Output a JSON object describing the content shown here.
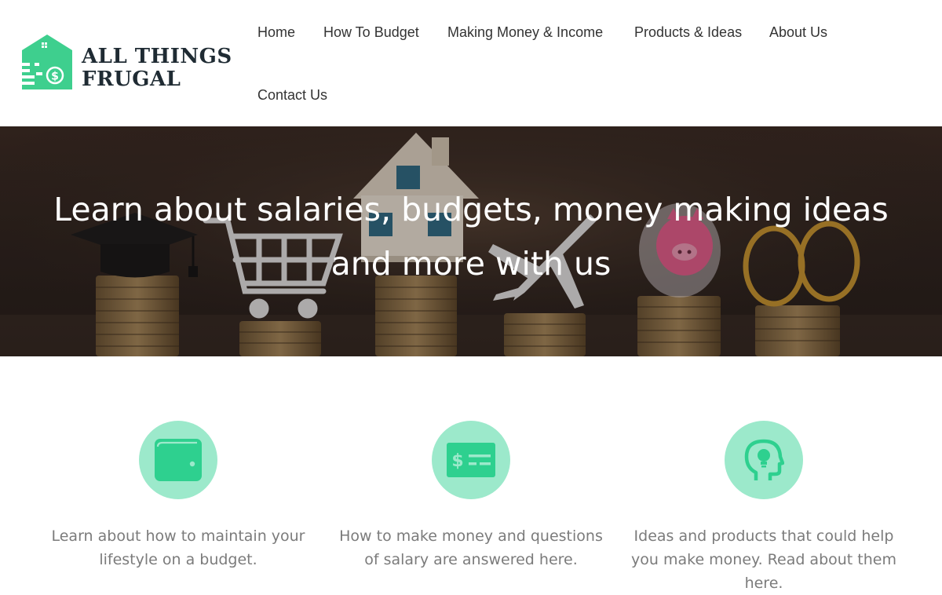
{
  "brand": {
    "line1": "ALL THINGS",
    "line2": "FRUGAL",
    "accent": "#3ecf8e",
    "dark": "#1f2b33"
  },
  "nav": {
    "items": [
      {
        "label": "Home"
      },
      {
        "label": "How To Budget"
      },
      {
        "label": "Making Money & Income"
      },
      {
        "label": "Products & Ideas"
      },
      {
        "label": "About Us"
      },
      {
        "label": "Contact Us"
      }
    ]
  },
  "hero": {
    "title": "Learn about salaries, budgets, money making ideas and more with us"
  },
  "features": [
    {
      "icon": "wallet-icon",
      "text": "Learn about how to maintain your lifestyle on a budget."
    },
    {
      "icon": "money-card-icon",
      "text": "How to make money and questions of salary are answered here."
    },
    {
      "icon": "head-lightbulb-icon",
      "text": "Ideas and products that could help you make money. Read about them here."
    }
  ],
  "colors": {
    "icon_circle": "#9ce9cb",
    "icon_fill": "#2ed08f",
    "feature_text": "#7b7b7b"
  }
}
